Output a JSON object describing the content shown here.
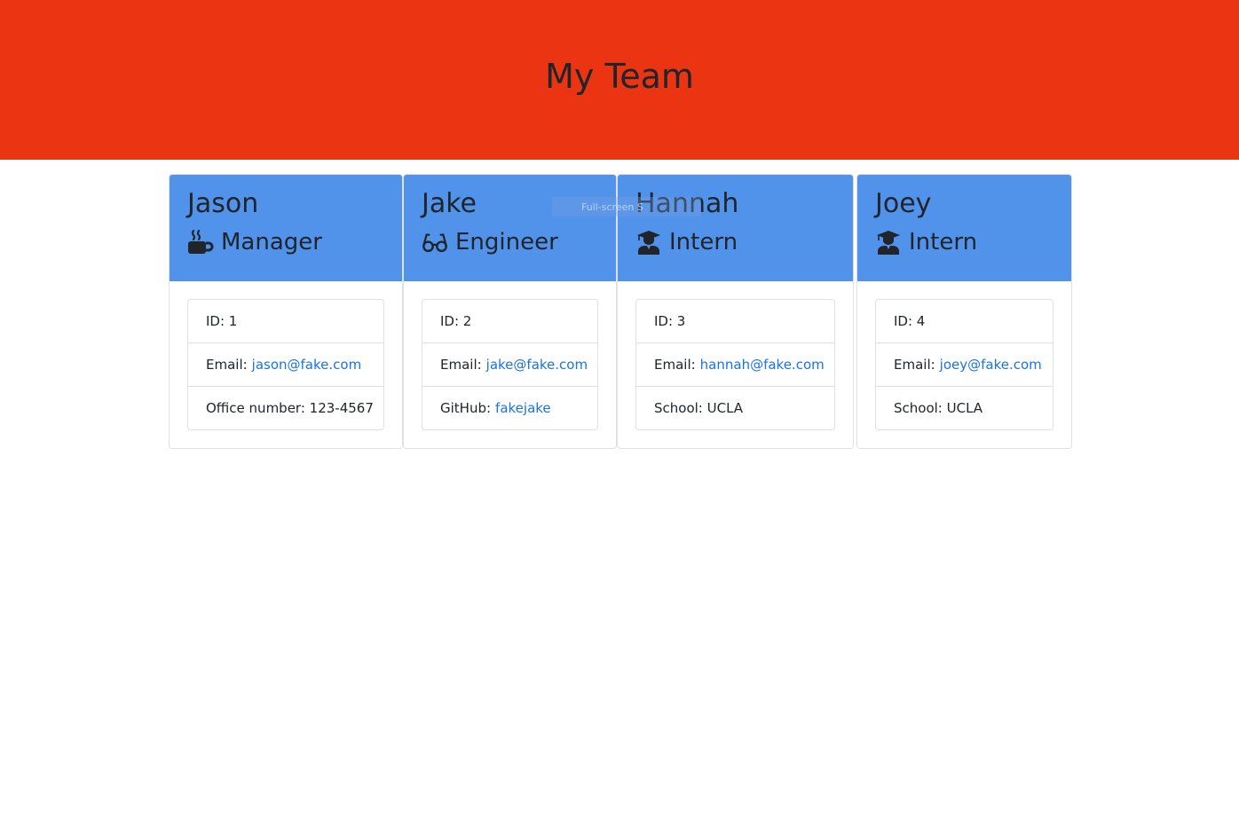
{
  "header": {
    "title": "My Team"
  },
  "members": [
    {
      "name": "Jason",
      "role": "Manager",
      "icon": "coffee-icon",
      "id_label": "ID: 1",
      "email_label": "Email:",
      "email": "jason@fake.com",
      "extra_label": "Office number: 123-4567",
      "extra_link": ""
    },
    {
      "name": "Jake",
      "role": "Engineer",
      "icon": "glasses-icon",
      "id_label": "ID: 2",
      "email_label": "Email:",
      "email": "jake@fake.com",
      "extra_label": "GitHub:",
      "extra_link": "fakejake"
    },
    {
      "name": "Hannah",
      "role": "Intern",
      "icon": "graduate-icon",
      "id_label": "ID: 3",
      "email_label": "Email:",
      "email": "hannah@fake.com",
      "extra_label": "School: UCLA",
      "extra_link": ""
    },
    {
      "name": "Joey",
      "role": "Intern",
      "icon": "graduate-icon",
      "id_label": "ID: 4",
      "email_label": "Email:",
      "email": "joey@fake.com",
      "extra_label": "School: UCLA",
      "extra_link": ""
    }
  ],
  "overlay": {
    "text": "Full-screen S"
  },
  "colors": {
    "header_bg": "#eb3512",
    "card_header_bg": "#5192ea",
    "link": "#1a73e8"
  }
}
